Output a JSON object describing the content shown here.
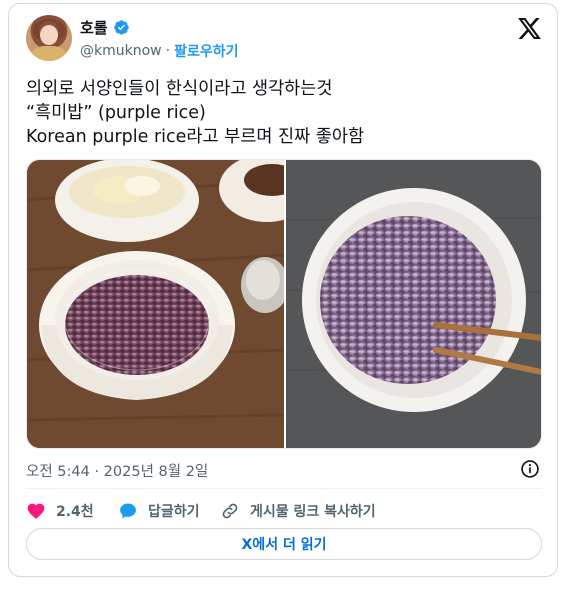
{
  "author": {
    "display_name": "호롤",
    "handle": "@kmuknow",
    "separator": "·",
    "follow_label": "팔로우하기"
  },
  "tweet": {
    "lines": [
      "의외로 서양인들이 한식이라고 생각하는것",
      "“흑미밥” (purple rice)",
      "Korean purple rice라고 부르며 진짜 좋아함"
    ],
    "timestamp": "오전 5:44 · 2025년 8월 2일"
  },
  "actions": {
    "like_count": "2.4천",
    "reply_label": "답글하기",
    "copy_link_label": "게시물 링크 복사하기"
  },
  "read_more_label": "X에서 더 읽기",
  "media": [
    {
      "name": "rice-bowl-photo-left",
      "watermark": ""
    },
    {
      "name": "rice-bowl-photo-right"
    }
  ],
  "colors": {
    "accent": "#1d9bf0",
    "like": "#f91880",
    "link": "#006fd6",
    "muted": "#536471"
  },
  "icons": [
    "verified-badge-icon",
    "x-logo-icon",
    "info-icon",
    "heart-icon",
    "reply-icon",
    "link-icon"
  ]
}
